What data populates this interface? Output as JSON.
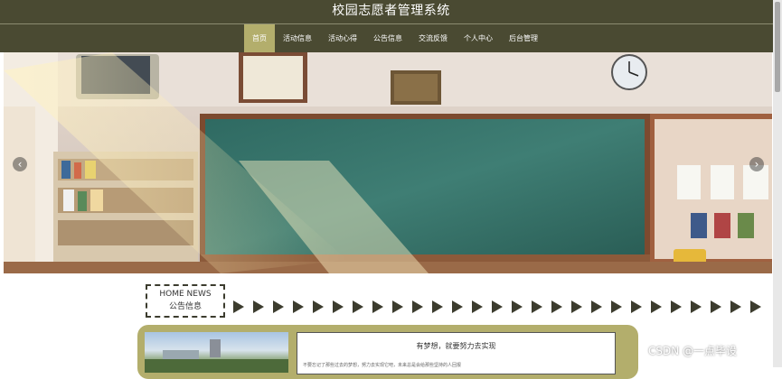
{
  "header": {
    "title": "校园志愿者管理系统"
  },
  "nav": {
    "items": [
      {
        "label": "首页",
        "active": true
      },
      {
        "label": "活动信息"
      },
      {
        "label": "活动心得"
      },
      {
        "label": "公告信息"
      },
      {
        "label": "交流反馈"
      },
      {
        "label": "个人中心"
      },
      {
        "label": "后台管理"
      }
    ]
  },
  "banner": {
    "prev_icon": "chevron-left-icon",
    "prev_glyph": "‹",
    "next_icon": "chevron-right-icon",
    "next_glyph": "›"
  },
  "news_section": {
    "label_en": "HOME NEWS",
    "label_cn": "公告信息"
  },
  "notice": {
    "title": "有梦想，就要努力去实现",
    "excerpt": "不要忘记了那些过去的梦想，努力去实现它吧，未来总是会给那些坚持的人回报"
  },
  "watermark": "CSDN @一点毕设",
  "colors": {
    "header_bg": "#4a4a32",
    "active_nav": "#b3ae6c",
    "panel": "#b3ae6c"
  }
}
